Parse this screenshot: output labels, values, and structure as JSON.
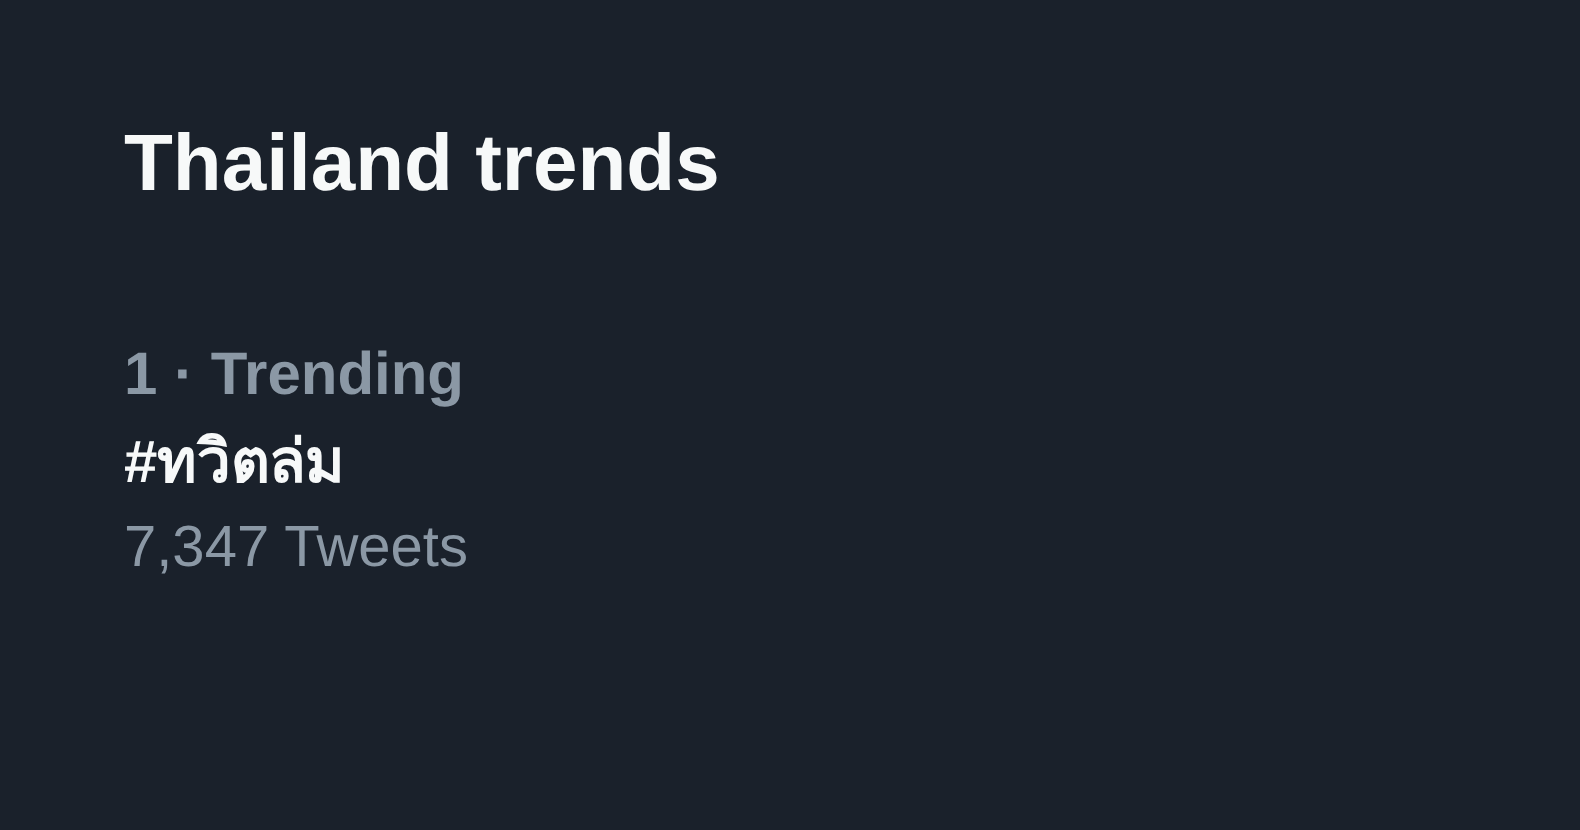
{
  "title": "Thailand trends",
  "trends": [
    {
      "meta": "1 · Trending",
      "name": "#ทวิตล่ม",
      "count": "7,347 Tweets"
    }
  ]
}
